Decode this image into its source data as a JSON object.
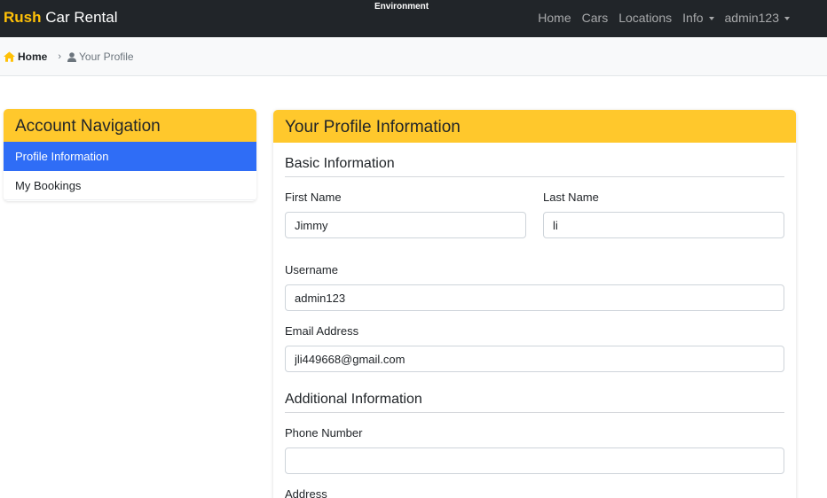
{
  "navbar": {
    "brand_accent": "Rush",
    "brand_rest": " Car Rental",
    "environment": "Environment",
    "links": [
      "Home",
      "Cars",
      "Locations"
    ],
    "info_label": "Info",
    "user_label": "admin123"
  },
  "breadcrumb": {
    "home": "Home",
    "current": "Your Profile"
  },
  "sidebar": {
    "title": "Account Navigation",
    "items": [
      {
        "label": "Profile Information"
      },
      {
        "label": "My Bookings"
      }
    ]
  },
  "profile": {
    "title": "Your Profile Information",
    "basic_title": "Basic Information",
    "first_name": {
      "label": "First Name",
      "value": "Jimmy"
    },
    "last_name": {
      "label": "Last Name",
      "value": "li"
    },
    "username": {
      "label": "Username",
      "value": "admin123"
    },
    "email": {
      "label": "Email Address",
      "value": "jli449668@gmail.com"
    },
    "additional_title": "Additional Information",
    "phone": {
      "label": "Phone Number",
      "value": ""
    },
    "address": {
      "label": "Address"
    }
  },
  "colors": {
    "navbar_bg": "#212529",
    "brand_accent": "#ffc107",
    "card_header": "#ffc82c",
    "active_item": "#2f6df6"
  },
  "icons": {
    "home": "home-icon",
    "profile": "person-icon",
    "dropdown": "caret-down-icon"
  }
}
